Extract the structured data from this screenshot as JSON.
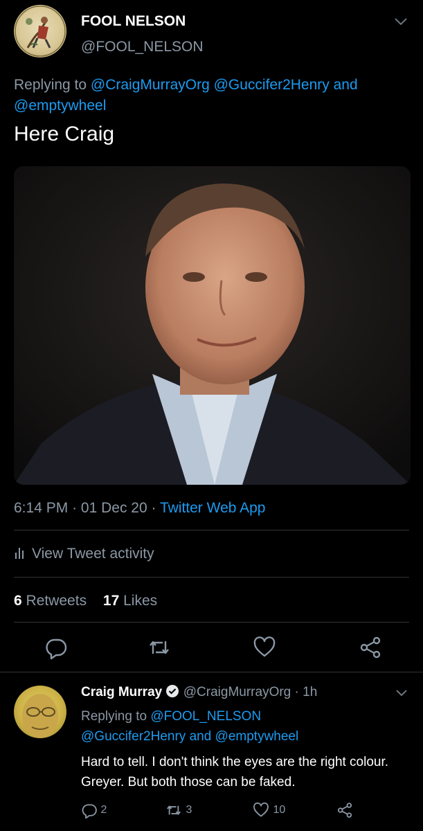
{
  "main_tweet": {
    "author_name": "FOOL NELSON",
    "author_handle": "@FOOL_NELSON",
    "replying_prefix": "Replying to",
    "replying_handles": "@CraigMurrayOrg @Guccifer2Henry and @emptywheel",
    "text": "Here Craig",
    "time": "6:14 PM",
    "date": "01 Dec 20",
    "source": "Twitter Web App",
    "activity_label": "View Tweet activity",
    "retweets_count": "6",
    "retweets_label": "Retweets",
    "likes_count": "17",
    "likes_label": "Likes"
  },
  "reply_tweet": {
    "author_name": "Craig Murray",
    "author_handle": "@CraigMurrayOrg",
    "age": "1h",
    "replying_prefix": "Replying to",
    "replying_handle_1": "@FOOL_NELSON",
    "replying_handle_2": "@Guccifer2Henry",
    "replying_and": "and",
    "replying_handle_3": "@emptywheel",
    "text": "Hard to tell. I don't think the eyes are the right colour. Greyer. But both those can be faked.",
    "reply_count": "2",
    "retweet_count": "3",
    "like_count": "10"
  },
  "colors": {
    "background": "#000000",
    "link": "#1d9bf0",
    "secondary_text": "#8b98a5",
    "verified_badge": "#e7e9ea"
  },
  "icons": [
    "chevron-down-icon",
    "reply-icon",
    "retweet-icon",
    "like-icon",
    "share-icon",
    "activity-bars-icon",
    "verified-badge-icon"
  ]
}
